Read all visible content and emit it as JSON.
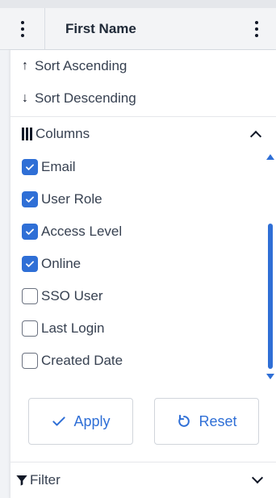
{
  "header": {
    "title": "First Name"
  },
  "menu": {
    "sort_asc": "Sort Ascending",
    "sort_desc": "Sort Descending",
    "columns": {
      "label": "Columns",
      "items": [
        {
          "label": "Email",
          "checked": true
        },
        {
          "label": "User Role",
          "checked": true
        },
        {
          "label": "Access Level",
          "checked": true
        },
        {
          "label": "Online",
          "checked": true
        },
        {
          "label": "SSO User",
          "checked": false
        },
        {
          "label": "Last Login",
          "checked": false
        },
        {
          "label": "Created Date",
          "checked": false
        }
      ]
    },
    "apply_label": "Apply",
    "reset_label": "Reset",
    "filter_label": "Filter"
  },
  "icons": {
    "sort_up": "arrow-up-icon",
    "sort_down": "arrow-down-icon",
    "columns": "columns-icon",
    "collapse": "chevron-up-icon",
    "expand": "chevron-down-icon",
    "apply": "check-icon",
    "reset": "refresh-icon",
    "filter": "funnel-icon"
  },
  "colors": {
    "accent": "#2f6fd6"
  }
}
